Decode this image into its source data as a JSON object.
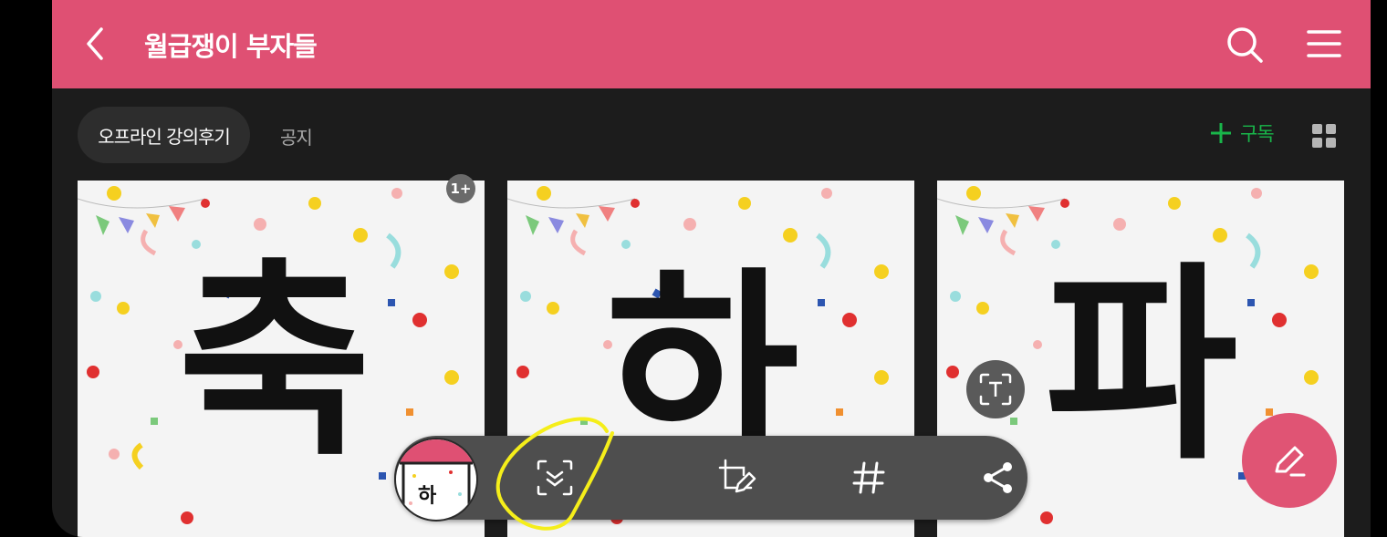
{
  "header": {
    "title": "월급쟁이 부자들",
    "bg_color": "#df5073"
  },
  "tabs": [
    {
      "label": "오프라인 강의후기",
      "active": true
    },
    {
      "label": "공지",
      "active": false
    }
  ],
  "subscribe": {
    "icon": "plus-icon",
    "label": "구독",
    "color": "#19b64a"
  },
  "cards": [
    {
      "char": "축",
      "badge": "1+"
    },
    {
      "char": "하"
    },
    {
      "char": "파"
    }
  ],
  "toolbar": {
    "thumbnail_char": "하",
    "buttons": [
      "smart-select-icon",
      "crop-edit-icon",
      "hashtag-icon",
      "share-icon"
    ]
  },
  "fab": {
    "icon": "pencil-icon",
    "color": "#e05474"
  }
}
